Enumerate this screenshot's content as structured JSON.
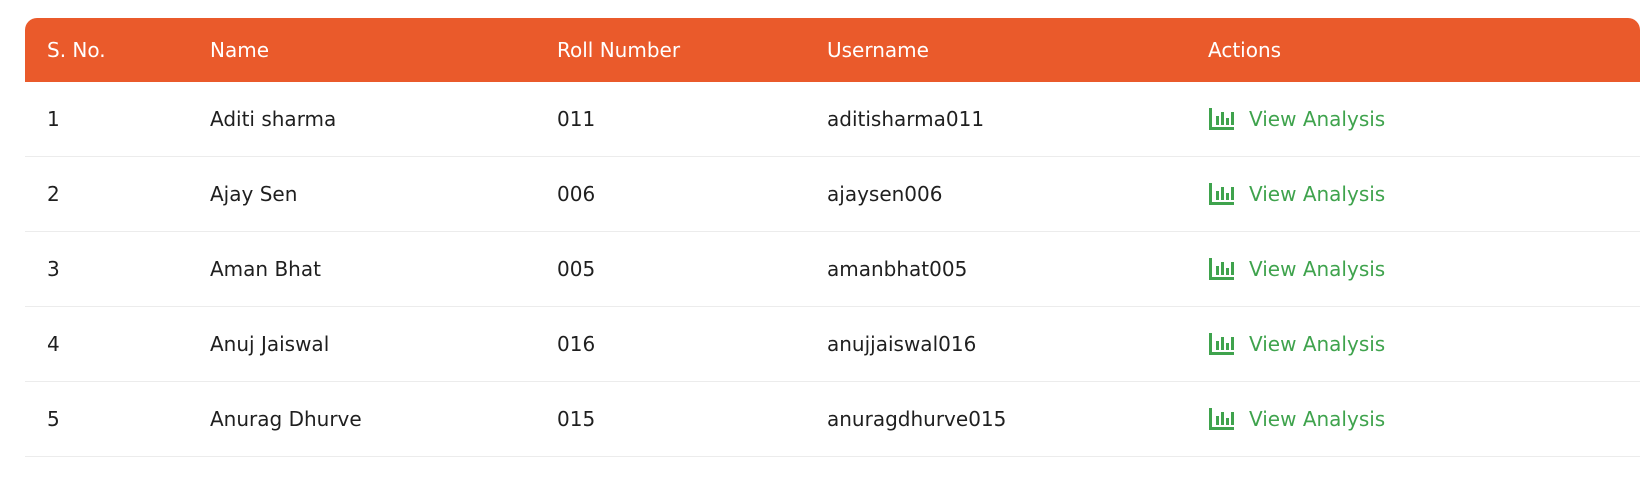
{
  "table": {
    "headers": {
      "sno": "S. No.",
      "name": "Name",
      "roll": "Roll Number",
      "username": "Username",
      "actions": "Actions"
    },
    "rows": [
      {
        "sno": "1",
        "name": "Aditi sharma",
        "roll": "011",
        "username": "aditisharma011",
        "action": "View Analysis"
      },
      {
        "sno": "2",
        "name": "Ajay Sen",
        "roll": "006",
        "username": "ajaysen006",
        "action": "View Analysis"
      },
      {
        "sno": "3",
        "name": "Aman Bhat",
        "roll": "005",
        "username": "amanbhat005",
        "action": "View Analysis"
      },
      {
        "sno": "4",
        "name": "Anuj Jaiswal",
        "roll": "016",
        "username": "anujjaiswal016",
        "action": "View Analysis"
      },
      {
        "sno": "5",
        "name": "Anurag Dhurve",
        "roll": "015",
        "username": "anuragdhurve015",
        "action": "View Analysis"
      }
    ]
  },
  "colors": {
    "header_bg": "#ea5a2b",
    "action": "#3fa34d"
  },
  "icons": {
    "action_icon": "bar-chart-icon"
  }
}
